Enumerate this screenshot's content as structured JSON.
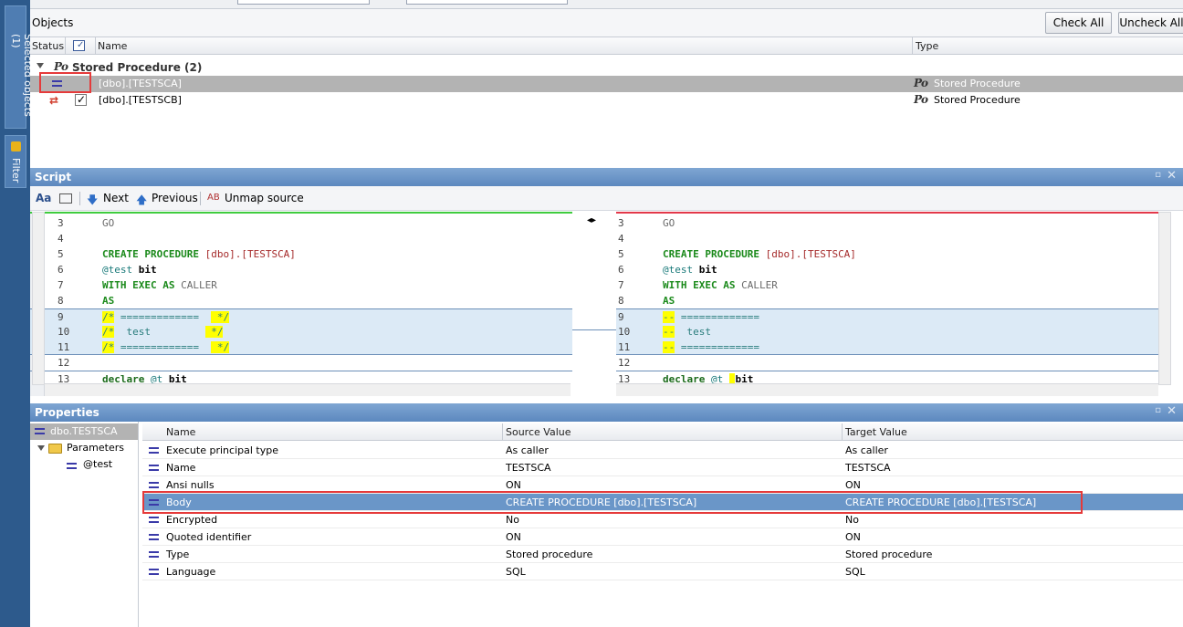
{
  "rail": {
    "selected_tab": "Selected objects (1)",
    "filter_tab": "Filter"
  },
  "objects": {
    "title": "Objects",
    "check_all": "Check All",
    "uncheck_all": "Uncheck All",
    "columns": {
      "status": "Status",
      "name": "Name",
      "type": "Type"
    },
    "group_label": "Stored Procedure (2)",
    "rows": [
      {
        "name": "[dbo].[TESTSCA]",
        "type": "Stored Procedure"
      },
      {
        "name": "[dbo].[TESTSCB]",
        "type": "Stored Procedure"
      }
    ]
  },
  "script": {
    "title": "Script",
    "next": "Next",
    "previous": "Previous",
    "unmap": "Unmap source"
  },
  "properties": {
    "title": "Properties",
    "tree": {
      "root": "dbo.TESTSCA",
      "parameters": "Parameters",
      "param": "@test"
    },
    "columns": {
      "name": "Name",
      "source": "Source Value",
      "target": "Target Value"
    },
    "rows": [
      {
        "name": "Execute principal type",
        "source": "As caller",
        "target": "As caller"
      },
      {
        "name": "Name",
        "source": "TESTSCA",
        "target": "TESTSCA"
      },
      {
        "name": "Ansi nulls",
        "source": "ON",
        "target": "ON"
      },
      {
        "name": "Body",
        "source": "CREATE PROCEDURE [dbo].[TESTSCA]",
        "target": "CREATE PROCEDURE [dbo].[TESTSCA]"
      },
      {
        "name": "Encrypted",
        "source": "No",
        "target": "No"
      },
      {
        "name": "Quoted identifier",
        "source": "ON",
        "target": "ON"
      },
      {
        "name": "Type",
        "source": "Stored procedure",
        "target": "Stored procedure"
      },
      {
        "name": "Language",
        "source": "SQL",
        "target": "SQL"
      }
    ]
  }
}
